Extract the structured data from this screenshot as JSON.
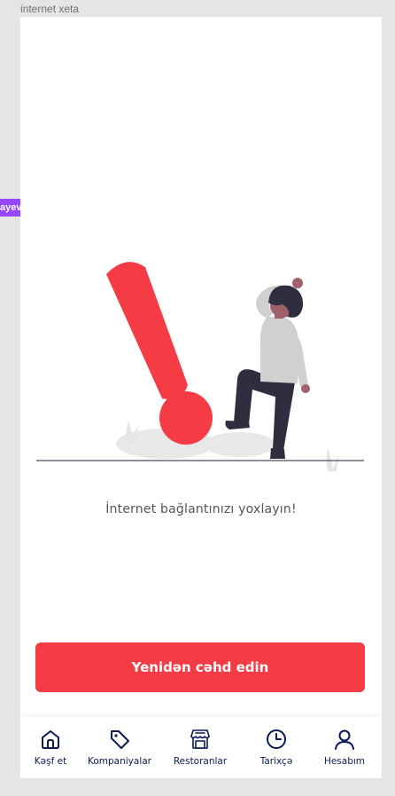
{
  "frame": {
    "label": "internet xeta",
    "side_tag": "ayev"
  },
  "error": {
    "message": "İnternet bağlantınızı yoxlayın!",
    "retry_label": "Yenidən cəhd edin"
  },
  "nav": {
    "items": [
      {
        "label": "Kəşf et",
        "icon": "home-icon"
      },
      {
        "label": "Kompaniyalar",
        "icon": "tag-icon"
      },
      {
        "label": "Restoranlar",
        "icon": "store-icon"
      },
      {
        "label": "Tarixçə",
        "icon": "clock-icon"
      },
      {
        "label": "Hesabım",
        "icon": "user-icon"
      }
    ]
  },
  "colors": {
    "accent": "#f53c45",
    "nav_text": "#0a1a52",
    "background": "#e5e5e5"
  }
}
